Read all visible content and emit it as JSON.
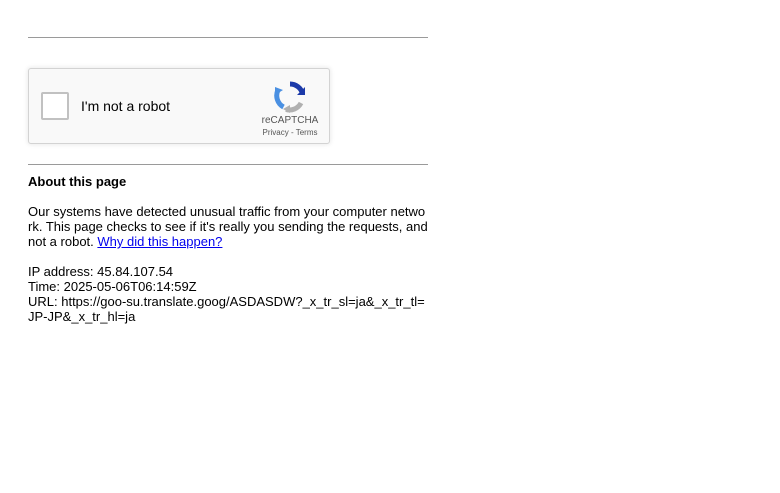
{
  "recaptcha": {
    "checkbox_label": "I'm not a robot",
    "brand": "reCAPTCHA",
    "privacy_label": "Privacy",
    "separator": " - ",
    "terms_label": "Terms",
    "checked": false
  },
  "about": {
    "title": "About this page",
    "body": "Our systems have detected unusual traffic from your computer network. This page checks to see if it's really you sending the requests, and not a robot. ",
    "why_link": "Why did this happen?"
  },
  "details": {
    "ip_line": "IP address: 45.84.107.54",
    "time_line": "Time: 2025-05-06T06:14:59Z",
    "url_line": "URL: https://goo-su.translate.goog/ASDASDW?_x_tr_sl=ja&_x_tr_tl=JP-JP&_x_tr_hl=ja"
  },
  "colors": {
    "link": "#0000ee",
    "divider": "#9a9a9a",
    "recaptcha_bg": "#f9f9f9",
    "recaptcha_blue": "#1c3aa9",
    "recaptcha_lightblue": "#4a90e2",
    "recaptcha_gray": "#b0b0b0"
  },
  "icons": {
    "recaptcha_logo": "recaptcha-logo-icon"
  }
}
